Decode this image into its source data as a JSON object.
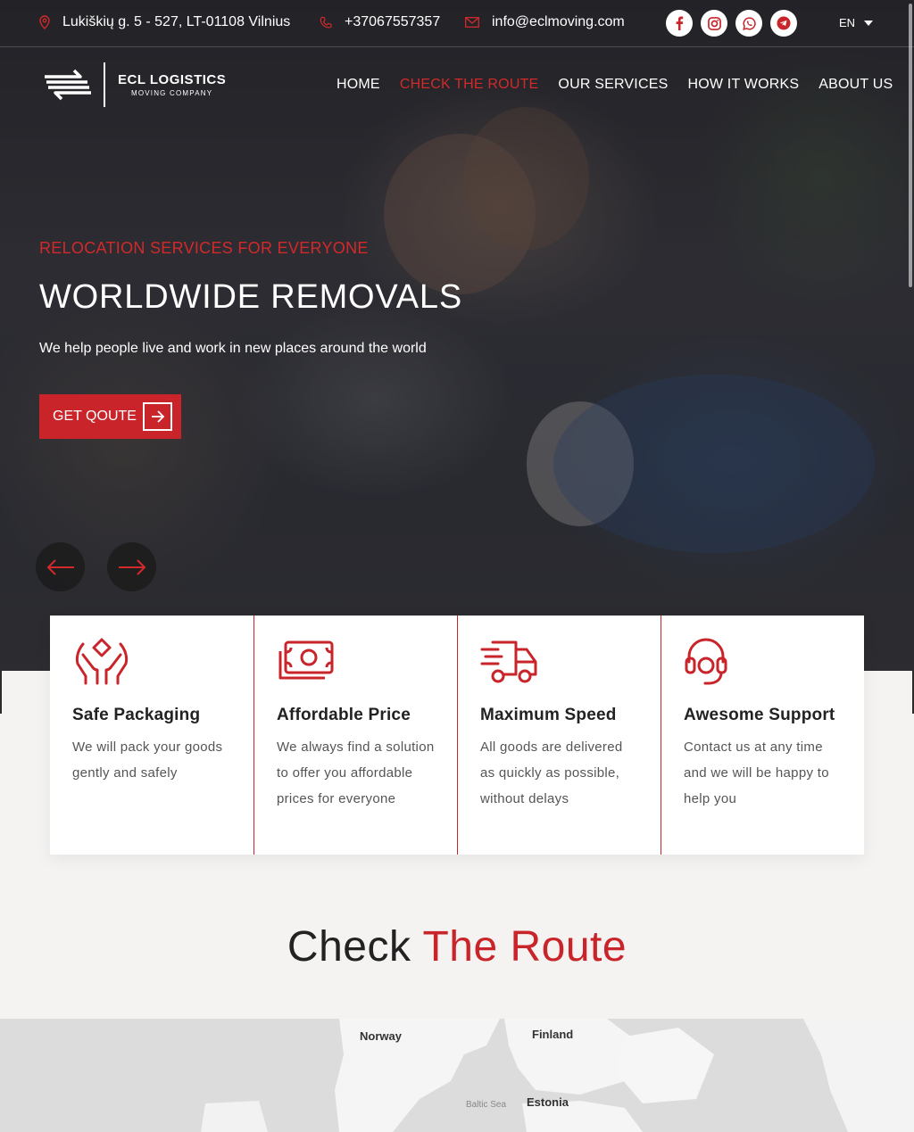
{
  "topbar": {
    "address": "Lukiškių g. 5 - 527, LT-01108 Vilnius",
    "phone": "+37067557357",
    "email": "info@eclmoving.com",
    "socials": [
      "facebook-icon",
      "instagram-icon",
      "whatsapp-icon",
      "telegram-icon"
    ],
    "language": "EN"
  },
  "header": {
    "logo_title": "ECL LOGISTICS",
    "logo_subtitle": "MOVING COMPANY",
    "nav": [
      {
        "label": "HOME",
        "active": false
      },
      {
        "label": "CHECK THE ROUTE",
        "active": true
      },
      {
        "label": "OUR SERVICES",
        "active": false
      },
      {
        "label": "HOW IT WORKS",
        "active": false
      },
      {
        "label": "ABOUT US",
        "active": false
      }
    ]
  },
  "hero": {
    "kicker": "RELOCATION SERVICES FOR EVERYONE",
    "title": "WORLDWIDE REMOVALS",
    "subtitle": "We help people live and work in new places around the world",
    "cta_label": "GET QOUTE"
  },
  "features": [
    {
      "icon": "hands-box-icon",
      "title": "Safe Packaging",
      "text": "We will pack your goods gently and safely"
    },
    {
      "icon": "banknote-icon",
      "title": "Affordable Price",
      "text": "We always find a solution to offer you affordable prices for everyone"
    },
    {
      "icon": "fast-truck-icon",
      "title": "Maximum Speed",
      "text": "All goods are delivered as quickly as possible, without delays"
    },
    {
      "icon": "headset-icon",
      "title": "Awesome Support",
      "text": "Contact us at any time and we will be happy to help you"
    }
  ],
  "route_section": {
    "heading_plain": "Check ",
    "heading_accent": "The Route"
  },
  "map": {
    "labels": [
      "Norway",
      "Finland",
      "Estonia",
      "Baltic Sea"
    ]
  },
  "colors": {
    "accent": "#c9242a",
    "dark": "#222222",
    "background": "#f4f3f2"
  }
}
